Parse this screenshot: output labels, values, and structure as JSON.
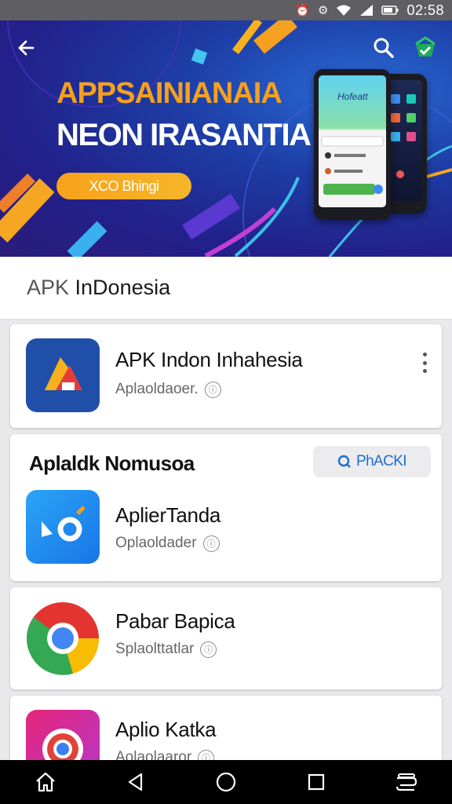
{
  "status_bar": {
    "time": "02:58",
    "icons": [
      "alarm-icon",
      "settings-icon",
      "wifi-icon",
      "signal-icon",
      "battery-icon"
    ]
  },
  "banner": {
    "headline": "APPSAINIANAIA",
    "subline": "NEON IRASANTIA",
    "cta_label": "XCO Bhingi",
    "phone_screen_title": "Hofeatt",
    "colors": {
      "headline": "#f4a020",
      "cta": "#f7a21b",
      "background": "#22208a"
    }
  },
  "section": {
    "prefix": "APK",
    "title": " InDonesia"
  },
  "featured_app": {
    "title": "APK Indon Inhahesia",
    "subtitle": "Aplaoldaoer."
  },
  "group": {
    "title": "Aplaldk Nomusoa",
    "pill_label": "PhACKI",
    "apps": [
      {
        "title": "AplierTanda",
        "subtitle": "Oplaoldader"
      },
      {
        "title": "Pabar Bapica",
        "subtitle": "Splaolttatlar"
      },
      {
        "title": "Aplio Katka",
        "subtitle": "Aolaolaaror"
      }
    ]
  },
  "nav_bar": {
    "items": [
      "home-icon",
      "back-icon",
      "circle-home-icon",
      "recents-icon",
      "switch-icon"
    ]
  }
}
